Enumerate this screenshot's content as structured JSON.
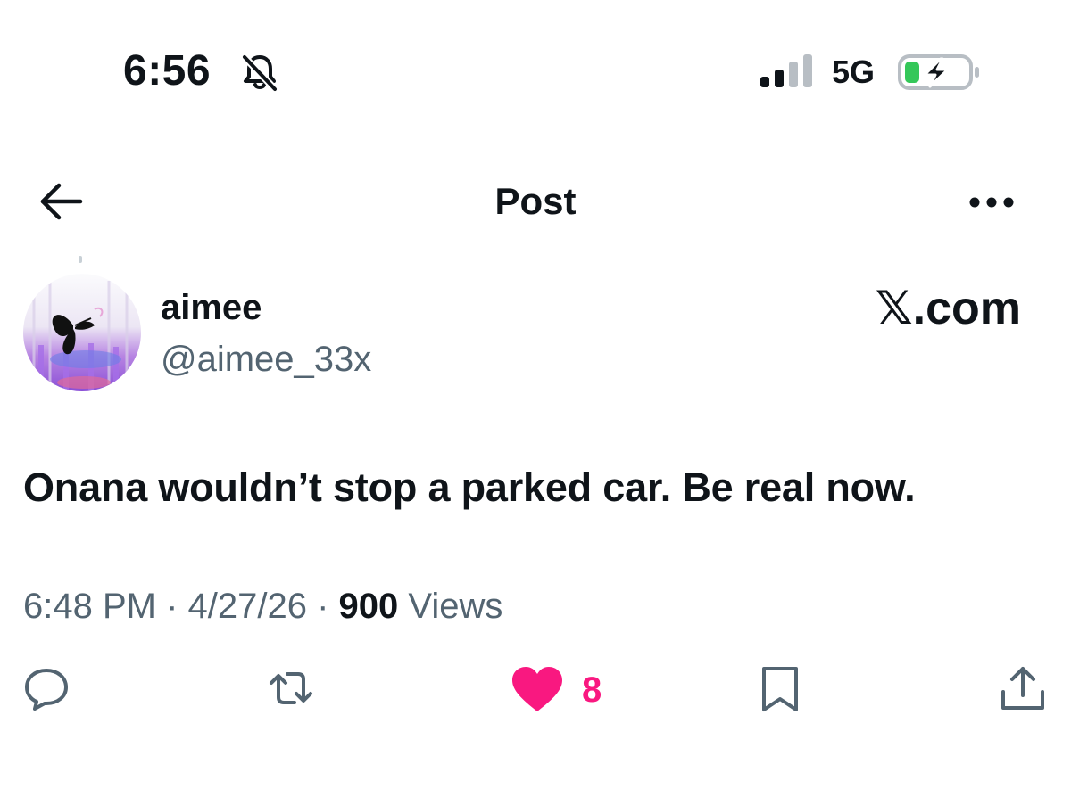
{
  "status_bar": {
    "time": "6:56",
    "mute_icon": "bell-slash-icon",
    "signal_icon": "cellular-signal-icon",
    "network": "5G",
    "battery_icon": "battery-charging-icon"
  },
  "header": {
    "back_icon": "arrow-left-icon",
    "title": "Post",
    "more_icon": "ellipsis-icon"
  },
  "author": {
    "display_name": "aimee",
    "handle": "@aimee_33x",
    "avatar": "butterfly-avatar"
  },
  "brand_label": "𝕏.com",
  "post": {
    "text": "Onana wouldn’t stop a parked car. Be real now.",
    "time": "6:48 PM",
    "sep1": " · ",
    "date": "4/27/26",
    "sep2": " · ",
    "views_count": "900",
    "views_label": "Views"
  },
  "actions": {
    "reply_icon": "reply-icon",
    "retweet_icon": "retweet-icon",
    "like_icon": "heart-filled-icon",
    "like_count": "8",
    "bookmark_icon": "bookmark-icon",
    "share_icon": "share-icon"
  },
  "colors": {
    "text": "#0f1419",
    "secondary": "#536471",
    "like": "#f91880",
    "battery_fill": "#34c759"
  }
}
